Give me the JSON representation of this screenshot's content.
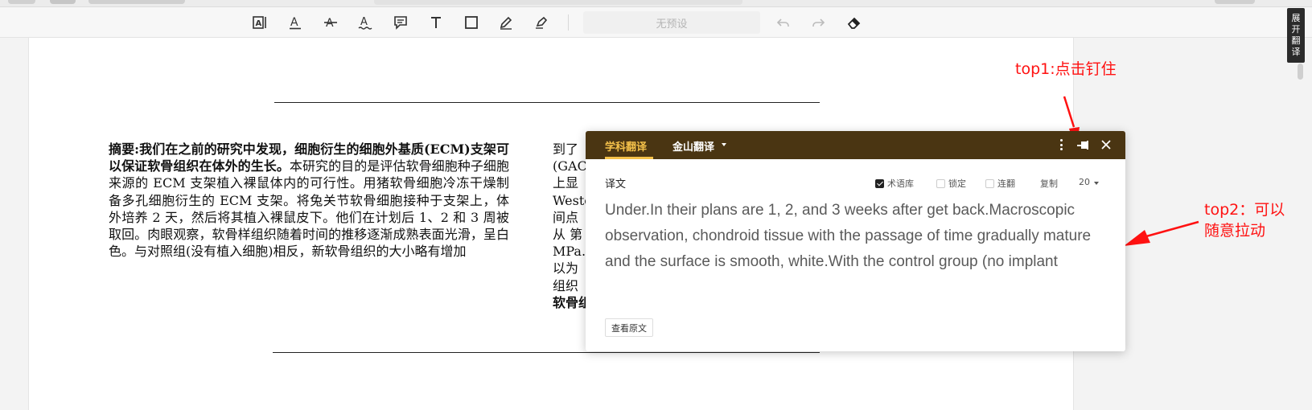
{
  "toolbar": {
    "icons": [
      "text-box-icon",
      "text-underline-icon",
      "text-strikethrough-icon",
      "text-squiggle-icon",
      "comment-icon",
      "text-icon",
      "rectangle-icon",
      "pen-icon",
      "highlighter-icon",
      "undo-icon",
      "redo-icon",
      "eraser-icon"
    ],
    "preset_placeholder": "无预设"
  },
  "side": {
    "expand_translate": [
      "展",
      "开",
      "翻",
      "译"
    ]
  },
  "document": {
    "abstract_bold_1": "摘要:我们在之前的研究中发现，细胞衍生的细胞外基质(ECM)支架可以保证软骨组织在体外的生长。",
    "abstract_text": "本研究的目的是评估软骨细胞种子细胞来源的 ECM 支架植入裸鼠体内的可行性。用猪软骨细胞冷冻干燥制备多孔细胞衍生的 ECM 支架。将兔关节软骨细胞接种于支架上，体外培养 2 天，然后将其植入裸鼠皮下。他们在计划后 1、2 和 3 周被取回。肉眼观察，软骨样组织随着时间的推移逐渐成熟表面光滑，呈白色。与对照组(没有植入细胞)相反，新软骨组织的大小略有增加",
    "right_col_lines": [
      "到了",
      "(GAC",
      "上显",
      "Weste",
      "间点",
      "从 第",
      "MPa.",
      "以为",
      "组织",
      "软骨组"
    ]
  },
  "annotations": {
    "top1": "top1:点击钉住",
    "top2_line1": "top2：可以",
    "top2_line2": "随意拉动"
  },
  "popup": {
    "tab_subject": "学科翻译",
    "tab_kingsoft": "金山翻译",
    "label": "译文",
    "options": {
      "glossary": "术语库",
      "lock": "锁定",
      "continuous": "连翻",
      "copy": "复制",
      "font_size": "20"
    },
    "option_states": {
      "glossary": true,
      "lock": false,
      "continuous": false
    },
    "translation": "Under.In their plans are 1, 2, and 3 weeks after get back.Macroscopic observation, chondroid tissue with the passage of time gradually mature and the surface is smooth, white.With the control group (no implant",
    "view_original": "查看原文"
  },
  "colors": {
    "popup_header": "#4a3512",
    "active_tab": "#f4c14a",
    "annotation": "#ff1111"
  }
}
